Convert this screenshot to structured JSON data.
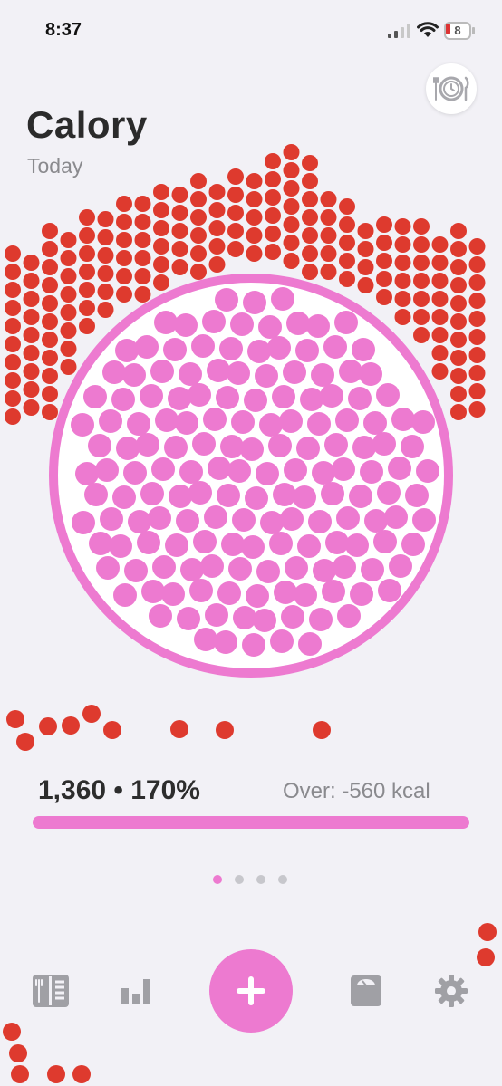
{
  "status_bar": {
    "time": "8:37",
    "battery_level": "8"
  },
  "header": {
    "title": "Calory",
    "subtitle": "Today"
  },
  "summary": {
    "value_text": "1,360 • 170%",
    "over_text": "Over: -560 kcal",
    "progress_fraction": 1.0
  },
  "pager": {
    "count": 4,
    "active_index": 0
  },
  "tabbar": {
    "items": [
      {
        "name": "diary",
        "icon": "menu-book-icon"
      },
      {
        "name": "stats",
        "icon": "bar-chart-icon"
      },
      {
        "name": "add",
        "icon": "plus-icon"
      },
      {
        "name": "weight",
        "icon": "scale-icon"
      },
      {
        "name": "settings",
        "icon": "gear-icon"
      }
    ]
  },
  "colors": {
    "background": "#f2f1f6",
    "accent_pink": "#ed7ad0",
    "over_red": "#de3a2e",
    "icon_gray": "#a0a0a5"
  }
}
